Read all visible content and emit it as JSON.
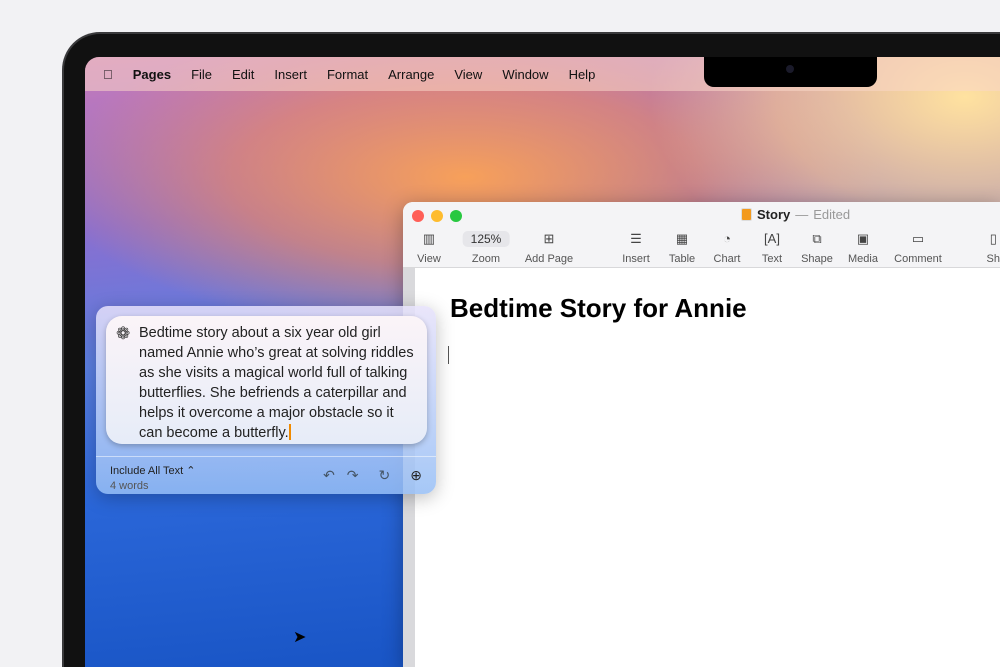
{
  "menubar": {
    "app": "Pages",
    "items": [
      "File",
      "Edit",
      "Insert",
      "Format",
      "Arrange",
      "View",
      "Window",
      "Help"
    ]
  },
  "window": {
    "title": "Story",
    "status": "Edited",
    "toolbar": [
      {
        "label": "View",
        "icon": "sidebar-icon"
      },
      {
        "label": "Zoom",
        "value": "125%"
      },
      {
        "label": "Add Page",
        "icon": "plus-square-icon"
      },
      {
        "label": "Insert",
        "icon": "list-icon"
      },
      {
        "label": "Table",
        "icon": "table-icon"
      },
      {
        "label": "Chart",
        "icon": "chart-icon"
      },
      {
        "label": "Text",
        "icon": "textbox-icon"
      },
      {
        "label": "Shape",
        "icon": "shape-icon"
      },
      {
        "label": "Media",
        "icon": "image-icon"
      },
      {
        "label": "Comment",
        "icon": "comment-icon"
      },
      {
        "label": "Sh"
      }
    ]
  },
  "document": {
    "title": "Bedtime Story for Annie"
  },
  "prompt": {
    "text": "Bedtime story about a six year old girl named Annie who’s great at solving riddles as she visits a magical world full of talking butterflies. She befriends a caterpillar and helps it overcome a major obstacle so it can become a butterfly.",
    "scope": "Include All Text ⌃",
    "word_count": "4 words"
  }
}
